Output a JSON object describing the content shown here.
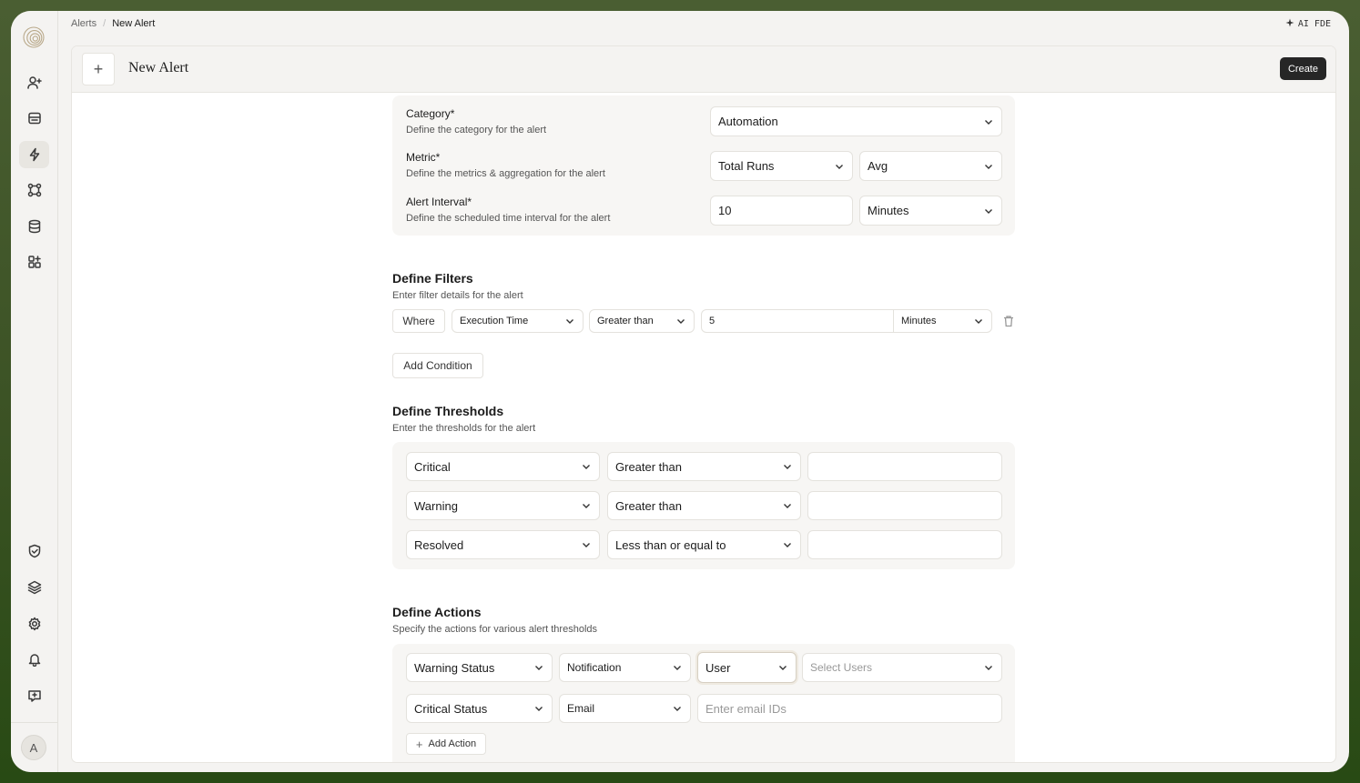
{
  "breadcrumb": {
    "root": "Alerts",
    "separator": "/",
    "current": "New Alert"
  },
  "topbar": {
    "ai_label": "AI FDE",
    "ai_icon": "sparkle-icon"
  },
  "header": {
    "title": "New Alert",
    "add_icon": "plus-icon",
    "create_label": "Create"
  },
  "sidebar": {
    "logo": "spiral-logo",
    "items": [
      {
        "name": "user-plus-icon"
      },
      {
        "name": "inbox-icon"
      },
      {
        "name": "bolt-icon",
        "active": true
      },
      {
        "name": "workflow-icon"
      },
      {
        "name": "database-icon"
      },
      {
        "name": "apps-icon"
      }
    ],
    "bottom": [
      {
        "name": "shield-check-icon"
      },
      {
        "name": "layers-icon"
      },
      {
        "name": "gear-icon"
      },
      {
        "name": "bell-icon"
      },
      {
        "name": "chat-icon"
      }
    ],
    "avatar": "A"
  },
  "config": {
    "category": {
      "label": "Category*",
      "desc": "Define the category for the alert",
      "value": "Automation"
    },
    "metric": {
      "label": "Metric*",
      "desc": "Define the metrics & aggregation for the alert",
      "value": "Total Runs",
      "aggregation": "Avg"
    },
    "interval": {
      "label": "Alert Interval*",
      "desc": "Define the scheduled time interval for the alert",
      "value": "10",
      "unit": "Minutes"
    }
  },
  "filters": {
    "title": "Define Filters",
    "subtitle": "Enter filter details for the alert",
    "row": {
      "where": "Where",
      "field": "Execution Time",
      "operator": "Greater than",
      "value": "5",
      "unit": "Minutes"
    },
    "add_label": "Add Condition"
  },
  "thresholds": {
    "title": "Define Thresholds",
    "subtitle": "Enter the thresholds for the alert",
    "rows": [
      {
        "level": "Critical",
        "operator": "Greater than",
        "value": ""
      },
      {
        "level": "Warning",
        "operator": "Greater than",
        "value": ""
      },
      {
        "level": "Resolved",
        "operator": "Less than or equal to",
        "value": ""
      }
    ]
  },
  "actions": {
    "title": "Define Actions",
    "subtitle": "Specify the actions for various alert thresholds",
    "rows": [
      {
        "status": "Warning Status",
        "channel": "Notification",
        "recipient_type": "User",
        "recipients_placeholder": "Select Users"
      },
      {
        "status": "Critical Status",
        "channel": "Email",
        "email_placeholder": "Enter email IDs"
      }
    ],
    "add_label": "Add Action"
  }
}
